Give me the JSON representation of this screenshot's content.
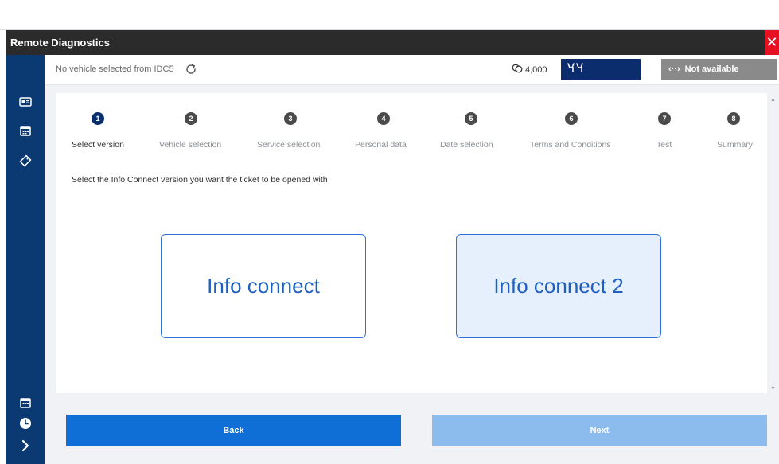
{
  "window": {
    "title": "Remote Diagnostics",
    "close_glyph": "✕"
  },
  "header": {
    "vehicle_text": "No vehicle selected from IDC5",
    "coins_value": "4,000",
    "not_available_label": "Not available",
    "not_available_glyph": "‹··›"
  },
  "sidebar": {
    "icons": [
      "card-icon",
      "calendar-icon",
      "tag-icon",
      "calendar-icon",
      "clock-icon",
      "chevron-right-icon"
    ]
  },
  "stepper": {
    "steps": [
      {
        "number": "1",
        "label": "Select version",
        "active": true
      },
      {
        "number": "2",
        "label": "Vehicle selection",
        "active": false
      },
      {
        "number": "3",
        "label": "Service selection",
        "active": false
      },
      {
        "number": "4",
        "label": "Personal data",
        "active": false
      },
      {
        "number": "5",
        "label": "Date selection",
        "active": false
      },
      {
        "number": "6",
        "label": "Terms and Conditions",
        "active": false
      },
      {
        "number": "7",
        "label": "Test",
        "active": false
      },
      {
        "number": "8",
        "label": "Summary",
        "active": false
      }
    ]
  },
  "main": {
    "instruction": "Select the Info Connect version you want the ticket to be opened with",
    "options": [
      {
        "label": "Info connect",
        "selected": false
      },
      {
        "label": "Info connect 2",
        "selected": true
      }
    ]
  },
  "footer": {
    "back_label": "Back",
    "next_label": "Next"
  },
  "colors": {
    "sidebar": "#0b3a73",
    "primary": "#0f6fd6",
    "disabled": "#8cbbee",
    "close": "#e81123"
  }
}
